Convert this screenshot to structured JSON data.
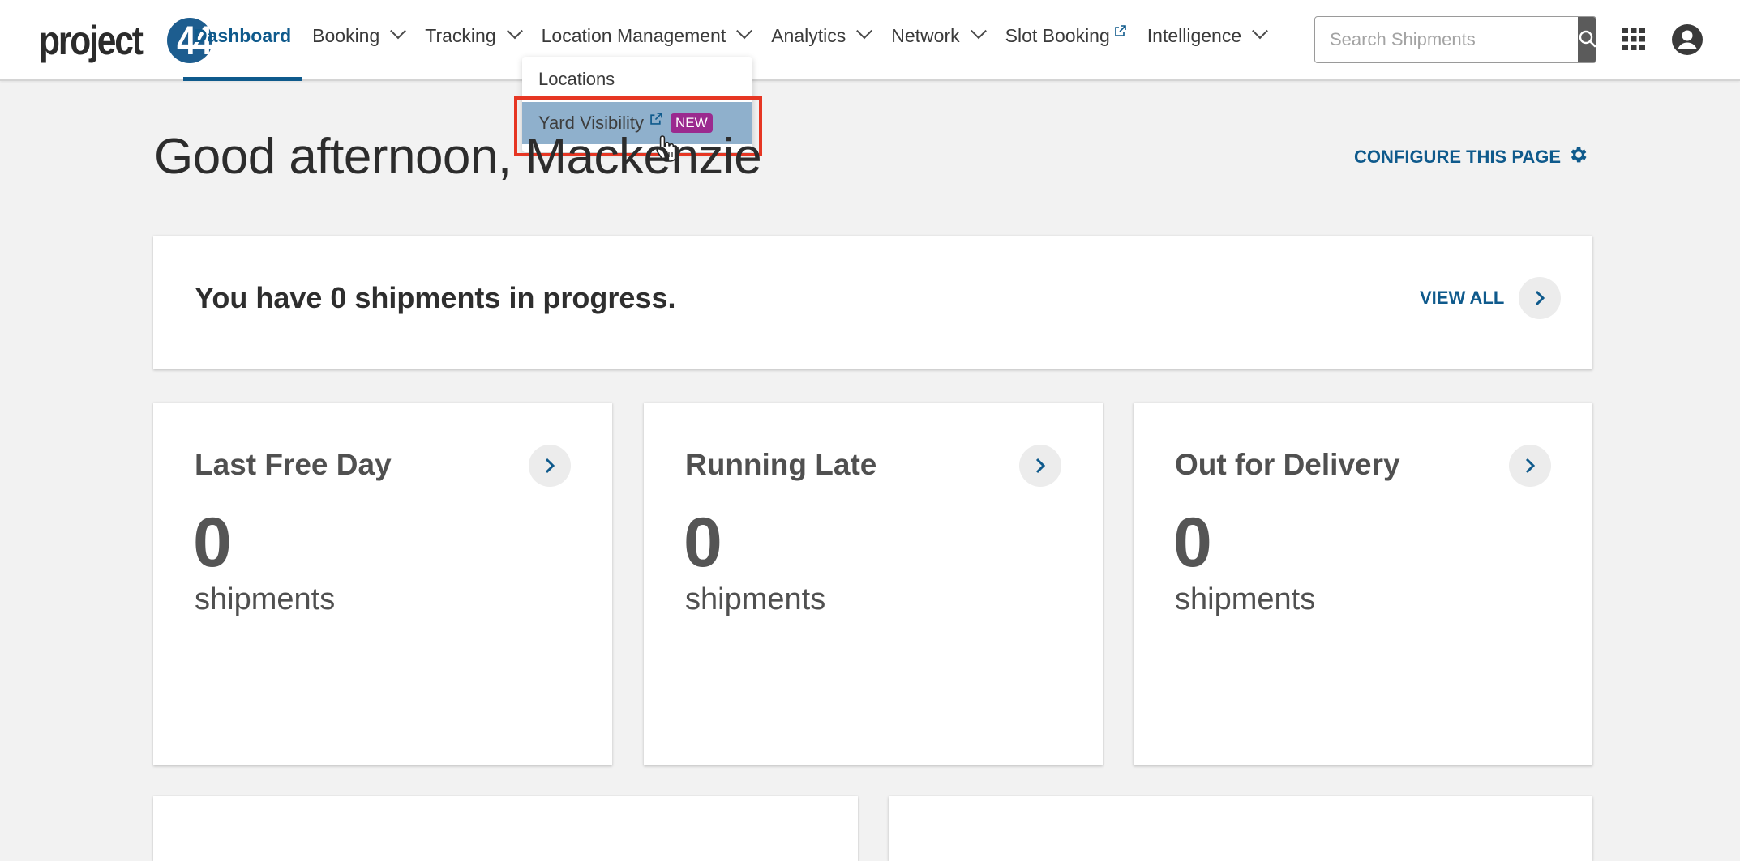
{
  "brand": {
    "logo_text": "project",
    "logo_number": "44"
  },
  "nav": {
    "items": [
      {
        "label": "Dashboard",
        "active": true
      },
      {
        "label": "Booking"
      },
      {
        "label": "Tracking"
      },
      {
        "label": "Location Management"
      },
      {
        "label": "Analytics"
      },
      {
        "label": "Network"
      },
      {
        "label": "Slot Booking"
      },
      {
        "label": "Intelligence"
      }
    ]
  },
  "search": {
    "placeholder": "Search Shipments"
  },
  "dropdown": {
    "items": [
      {
        "label": "Locations"
      },
      {
        "label": "Yard Visibility",
        "badge": "NEW"
      }
    ]
  },
  "greeting": "Good afternoon, Mackenzie",
  "configure_label": "CONFIGURE THIS PAGE",
  "progress": {
    "text": "You have 0 shipments in progress.",
    "view_all": "VIEW ALL"
  },
  "stats": [
    {
      "title": "Last Free Day",
      "value": "0",
      "unit": "shipments"
    },
    {
      "title": "Running Late",
      "value": "0",
      "unit": "shipments"
    },
    {
      "title": "Out for Delivery",
      "value": "0",
      "unit": "shipments"
    }
  ],
  "colors": {
    "brand_blue": "#0f5a8c",
    "highlight_red": "#e63623",
    "new_badge": "#9b2a8f",
    "dropdown_hover": "#8fb0cc"
  }
}
